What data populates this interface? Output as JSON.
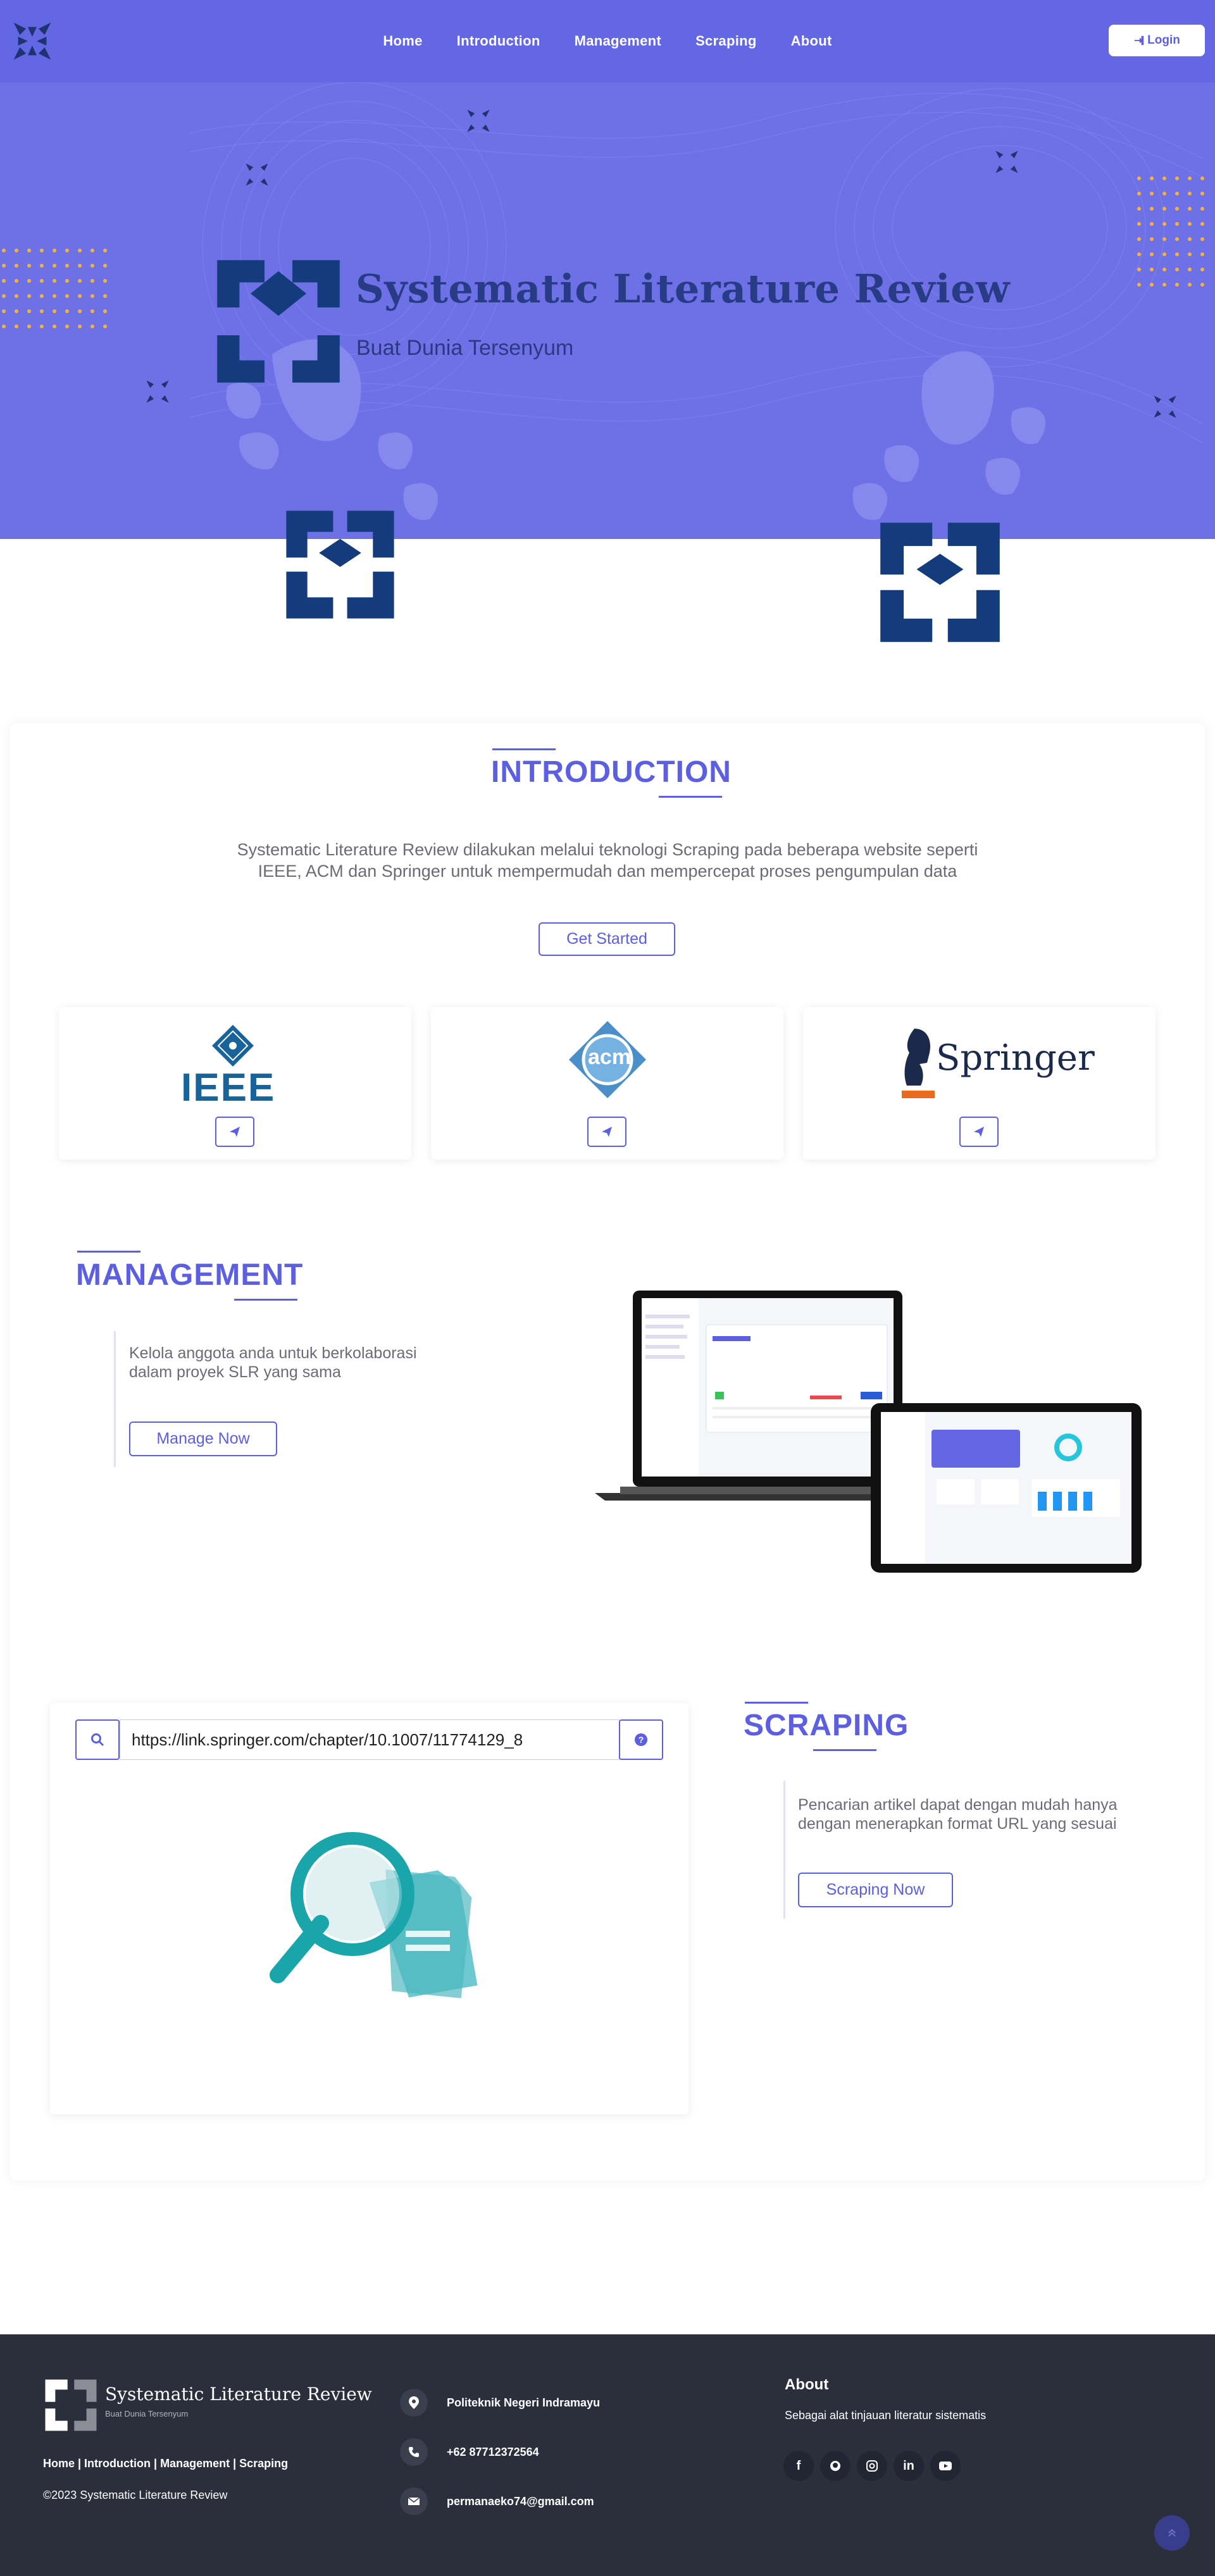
{
  "nav": {
    "links": [
      "Home",
      "Introduction",
      "Management",
      "Scraping",
      "About"
    ],
    "login_label": "Login"
  },
  "hero": {
    "title": "Systematic Literature Review",
    "subtitle": "Buat Dunia Tersenyum"
  },
  "introduction": {
    "title": "INTRODUCTION",
    "text": "Systematic Literature Review dilakukan melalui teknologi Scraping pada beberapa website seperti IEEE, ACM dan Springer untuk mempermudah dan mempercepat proses pengumpulan data",
    "button": "Get Started",
    "sources": [
      {
        "name": "IEEE"
      },
      {
        "name": "acm"
      },
      {
        "name": "Springer"
      }
    ]
  },
  "management": {
    "title": "MANAGEMENT",
    "text": "Kelola anggota anda untuk berkolaborasi dalam proyek SLR yang sama",
    "button": "Manage Now"
  },
  "scraping": {
    "title": "SCRAPING",
    "url_value": "https://link.springer.com/chapter/10.1007/11774129_8",
    "text": "Pencarian artikel dapat dengan mudah hanya dengan menerapkan format URL yang sesuai",
    "button": "Scraping Now"
  },
  "footer": {
    "brand_title": "Systematic Literature Review",
    "brand_subtitle": "Buat Dunia Tersenyum",
    "links": "Home | Introduction | Management | Scraping",
    "copyright": "©2023 Systematic Literature Review",
    "address": "Politeknik Negeri Indramayu",
    "phone": "+62 87712372564",
    "email": "permanaeko74@gmail.com",
    "about_title": "About",
    "about_text": "Sebagai alat tinjauan literatur sistematis"
  },
  "colors": {
    "primary": "#5c5fe0",
    "hero_bg": "#6e70e6",
    "logo_navy": "#143c7c",
    "footer_bg": "#2b2f3c"
  }
}
